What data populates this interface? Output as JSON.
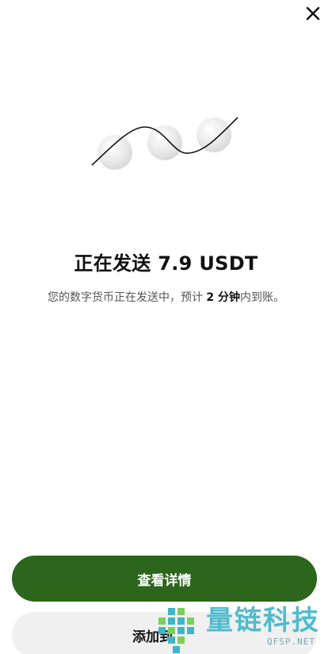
{
  "header": {
    "close_icon": "close-icon"
  },
  "illustration": {
    "icon": "coins-wave-illustration"
  },
  "status": {
    "title": "正在发送 7.9 USDT",
    "subtitle_prefix": "您的数字货币正在发送中，预计 ",
    "subtitle_eta": "2 分钟",
    "subtitle_suffix": "内到账。"
  },
  "actions": {
    "primary_label": "查看详情",
    "secondary_label": "添加到"
  },
  "watermark": {
    "main": "量链科技",
    "sub": "QFSP.NET"
  },
  "colors": {
    "primary": "#2c661d",
    "secondary_bg": "#f0f0f0",
    "watermark": "#3fb6c8"
  }
}
